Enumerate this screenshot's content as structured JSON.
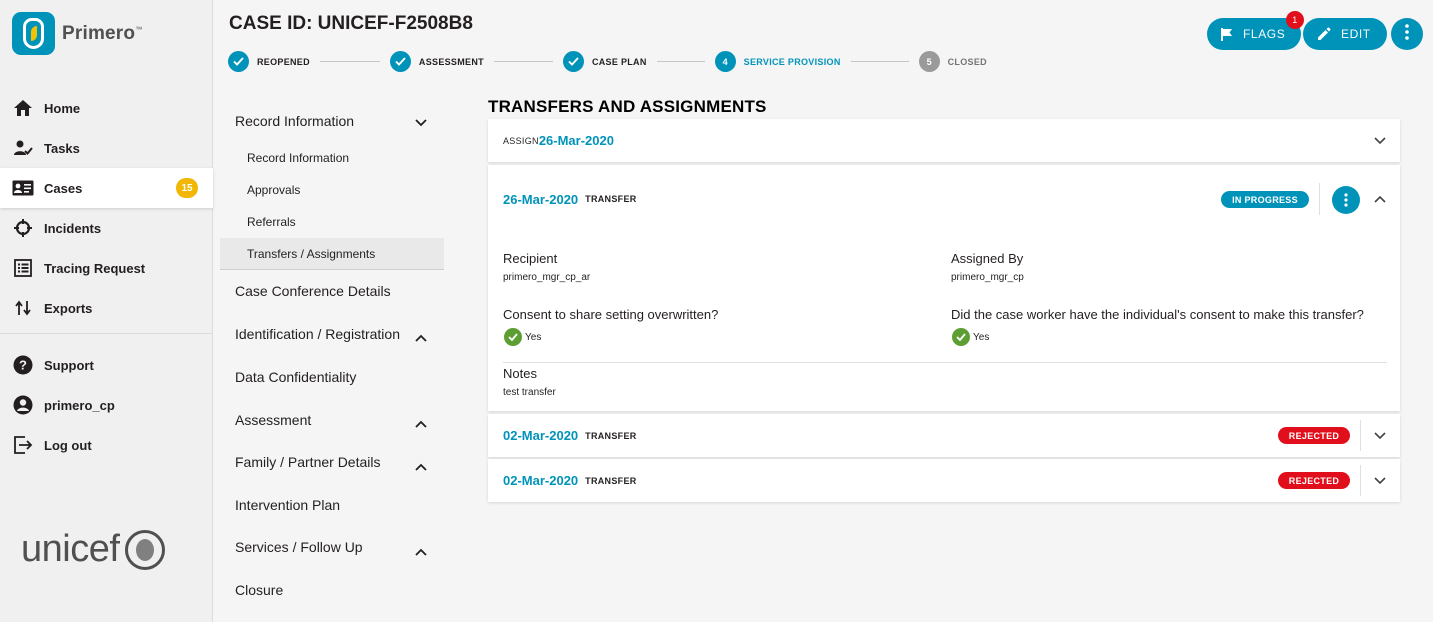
{
  "app": {
    "name": "Primero",
    "trademark": "™"
  },
  "nav": {
    "items": [
      {
        "label": "Home",
        "icon": "home-icon"
      },
      {
        "label": "Tasks",
        "icon": "tasks-icon"
      },
      {
        "label": "Cases",
        "icon": "cases-icon",
        "badge": "15",
        "active": true
      },
      {
        "label": "Incidents",
        "icon": "incidents-icon"
      },
      {
        "label": "Tracing Request",
        "icon": "tracing-request-icon"
      },
      {
        "label": "Exports",
        "icon": "exports-icon"
      }
    ],
    "secondary": [
      {
        "label": "Support",
        "icon": "support-icon"
      },
      {
        "label": "primero_cp",
        "icon": "account-icon"
      },
      {
        "label": "Log out",
        "icon": "logout-icon"
      }
    ],
    "partner_logo": "unicef"
  },
  "header": {
    "case_title": "CASE ID: UNICEF-F2508B8",
    "flags_label": "FLAGS",
    "flags_count": "1",
    "edit_label": "EDIT"
  },
  "workflow": {
    "steps": [
      {
        "label": "REOPENED",
        "state": "done",
        "number": ""
      },
      {
        "label": "ASSESSMENT",
        "state": "done",
        "number": ""
      },
      {
        "label": "CASE PLAN",
        "state": "done",
        "number": ""
      },
      {
        "label": "SERVICE PROVISION",
        "state": "current",
        "number": "4"
      },
      {
        "label": "CLOSED",
        "state": "future",
        "number": "5"
      }
    ]
  },
  "form_nav": {
    "groups": [
      {
        "label": "Record Information",
        "chevron": "down",
        "children": [
          "Record Information",
          "Approvals",
          "Referrals",
          "Transfers / Assignments"
        ],
        "selected_child": "Transfers / Assignments"
      },
      {
        "label": "Case Conference Details"
      },
      {
        "label": "Identification / Registration",
        "chevron": "up"
      },
      {
        "label": "Data Confidentiality"
      },
      {
        "label": "Assessment",
        "chevron": "up"
      },
      {
        "label": "Family / Partner Details",
        "chevron": "up"
      },
      {
        "label": "Intervention Plan"
      },
      {
        "label": "Services / Follow Up",
        "chevron": "up"
      },
      {
        "label": "Closure"
      }
    ]
  },
  "transfers": {
    "title": "TRANSFERS AND ASSIGNMENTS",
    "assign_row": {
      "type": "ASSIGN",
      "date": "26-Mar-2020"
    },
    "expanded": {
      "date": "26-Mar-2020",
      "type": "TRANSFER",
      "status": "IN PROGRESS",
      "recipient_label": "Recipient",
      "recipient_value": "primero_mgr_cp_ar",
      "assigned_by_label": "Assigned By",
      "assigned_by_value": "primero_mgr_cp",
      "consent_override_label": "Consent to share setting overwritten?",
      "consent_override_value": "Yes",
      "consent_individual_label": "Did the case worker have the individual's consent to make this transfer?",
      "consent_individual_value": "Yes",
      "notes_label": "Notes",
      "notes_value": "test transfer"
    },
    "rows": [
      {
        "date": "02-Mar-2020",
        "type": "TRANSFER",
        "status": "REJECTED"
      },
      {
        "date": "02-Mar-2020",
        "type": "TRANSFER",
        "status": "REJECTED"
      }
    ]
  },
  "colors": {
    "primary": "#0093ba",
    "rejected": "#e10f1b",
    "badge": "#f2b705",
    "check": "#5c9e31"
  }
}
